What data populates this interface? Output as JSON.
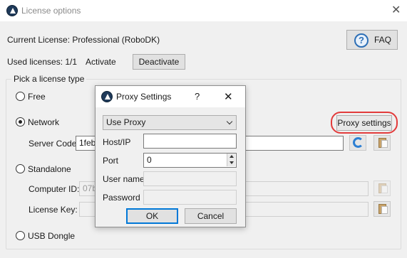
{
  "window": {
    "title": "License options",
    "close_glyph": "✕"
  },
  "header": {
    "current_license": "Current License: Professional (RoboDK)",
    "used_licenses": "Used licenses: 1/1",
    "activate_label": "Activate",
    "deactivate_label": "Deactivate",
    "faq_label": "FAQ",
    "faq_icon_glyph": "?"
  },
  "license_group": {
    "title": "Pick a license type",
    "options": {
      "free": "Free",
      "network": "Network",
      "standalone": "Standalone",
      "usb": "USB Dongle"
    },
    "selected": "network",
    "proxy_settings_label": "Proxy settings",
    "server_code_label": "Server Code",
    "server_code_value": "1feb",
    "computer_id_label": "Computer ID:",
    "computer_id_value": "07b",
    "license_key_label": "License Key:"
  },
  "proxy_dialog": {
    "title": "Proxy Settings",
    "help_glyph": "?",
    "close_glyph": "✕",
    "mode_value": "Use Proxy",
    "host_label": "Host/IP",
    "host_value": "",
    "port_label": "Port",
    "port_value": "0",
    "username_label": "User name",
    "password_label": "Password",
    "ok_label": "OK",
    "cancel_label": "Cancel"
  },
  "colors": {
    "highlight": "#e23b3b",
    "focus_blue": "#0078d7",
    "brand": "#1f3a5a"
  }
}
